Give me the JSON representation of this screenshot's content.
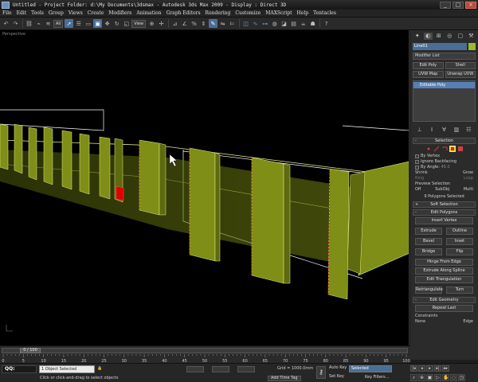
{
  "window": {
    "title": "Untitled    - Project Folder: d:\\My Documents\\3dsmax    - Autodesk 3ds Max  2009       - Display : Direct 3D",
    "minimize": "_",
    "maximize": "□",
    "close": "×"
  },
  "menu": [
    "File",
    "Edit",
    "Tools",
    "Group",
    "Views",
    "Create",
    "Modifiers",
    "Animation",
    "Graph Editors",
    "Rendering",
    "Customize",
    "MAXScript",
    "Help",
    "Tentacles"
  ],
  "toolbar": {
    "filter_dropdown": "All",
    "refcoord_dropdown": "View"
  },
  "viewport": {
    "label": "Perspective",
    "colors": {
      "poly_fill": "#7c8c14",
      "poly_fill_dark": "#4d5a0c",
      "poly_edge": "#e6f08a",
      "wire": "#ffffff",
      "selected_face": "#e00000"
    }
  },
  "command_panel": {
    "object_name": "Line01",
    "object_color": "#9abb2a",
    "modifier_list": "Modifier List",
    "modifier_buttons": [
      "Edit Poly",
      "Shell",
      "UVW Map",
      "Unwrap UVW"
    ],
    "stack_item": "Editable Poly",
    "selection": {
      "header": "Selection",
      "by_vertex": "By Vertex",
      "ignore_backfacing": "Ignore Backfacing",
      "by_angle": "By Angle:",
      "by_angle_value": "45.0",
      "shrink": "Shrink",
      "grow": "Grow",
      "ring": "Ring",
      "loop": "Loop",
      "preview_selection": "Preview Selection",
      "preview_off": "Off",
      "preview_subobj": "SubObj",
      "preview_multi": "Multi",
      "selected_info": "9 Polygons Selected"
    },
    "soft_selection": "Soft Selection",
    "edit_polygons": {
      "header": "Edit Polygons",
      "insert_vertex": "Insert Vertex",
      "extrude": "Extrude",
      "outline": "Outline",
      "bevel": "Bevel",
      "inset": "Inset",
      "bridge": "Bridge",
      "flip": "Flip",
      "hinge": "Hinge From Edge",
      "extrude_spline": "Extrude Along Spline",
      "edit_triangulation": "Edit Triangulation",
      "retriangulate": "Retriangulate",
      "turn": "Turn"
    },
    "edit_geometry": {
      "header": "Edit Geometry",
      "repeat_last": "Repeat Last",
      "constraints": "Constraints",
      "none": "None",
      "edge": "Edge"
    }
  },
  "timeline": {
    "frame_readout": "0 / 100",
    "ticks": [
      "0",
      "5",
      "10",
      "15",
      "20",
      "25",
      "30",
      "35",
      "40",
      "45",
      "50",
      "55",
      "60",
      "65",
      "70",
      "75",
      "80",
      "85",
      "90",
      "95",
      "100"
    ]
  },
  "status": {
    "qq": "QQ:",
    "maxscript_text": "1 Object Selected",
    "prompt": "Click or click-and-drag to select objects",
    "grid": "Grid = 1000.0mm",
    "add_time_tag": "Add Time Tag",
    "auto_key": "Auto Key",
    "set_key": "Set Key",
    "selected_dropdown": "Selected",
    "key_filters": "Key Filters..."
  }
}
